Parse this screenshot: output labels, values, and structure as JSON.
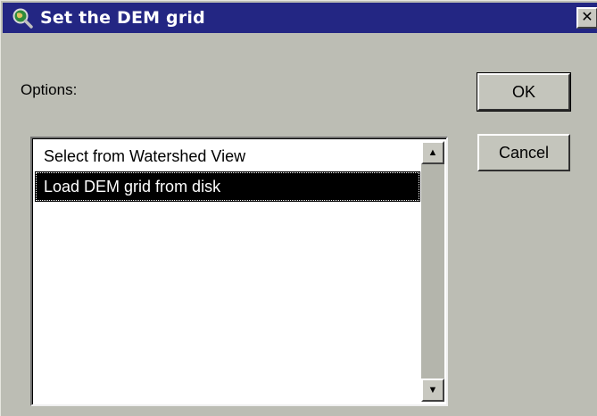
{
  "window": {
    "title": "Set the DEM grid",
    "title_icon": "magnifier-globe-icon",
    "close_glyph": "✕"
  },
  "dialog": {
    "options_label": "Options:",
    "ok_label": "OK",
    "cancel_label": "Cancel"
  },
  "listbox": {
    "items": [
      {
        "label": "Select from Watershed View",
        "selected": false
      },
      {
        "label": "Load DEM grid from disk",
        "selected": true
      }
    ],
    "scroll_up_glyph": "▲",
    "scroll_down_glyph": "▼"
  },
  "colors": {
    "titlebar": "#232683",
    "dialog_bg": "#bcbdb4",
    "selection_bg": "#000000"
  }
}
